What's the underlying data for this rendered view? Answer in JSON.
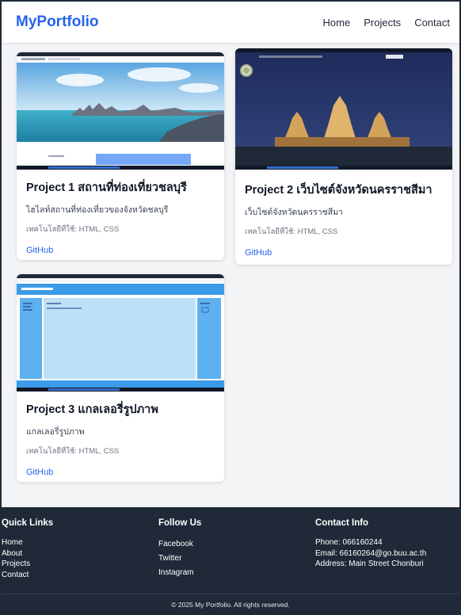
{
  "header": {
    "brand": "MyPortfolio",
    "nav": [
      "Home",
      "Projects",
      "Contact"
    ]
  },
  "projects": [
    {
      "title": "Project 1 สถานที่ท่องเที่ยวชลบุรี",
      "description": "ไฮไลท์สถานที่ท่องเที่ยวของจังหวัดชลบุรี",
      "tech": "เทคโนโลยีที่ใช้: HTML, CSS",
      "link": "GitHub"
    },
    {
      "title": "Project 2 เว็บไซต์จังหวัดนครราชสีมา",
      "description": "เว็บไซต์จังหวัดนครราชสีมา",
      "tech": "เทคโนโลยีที่ใช้: HTML, CSS",
      "link": "GitHub"
    },
    {
      "title": "Project 3 แกลเลอรี่รูปภาพ",
      "description": "แกลเลอรี่รูปภาพ",
      "tech": "เทคโนโลยีที่ใช้: HTML, CSS",
      "link": "GitHub"
    }
  ],
  "footer": {
    "quick_links_title": "Quick Links",
    "quick_links": [
      "Home",
      "About",
      "Projects",
      "Contact"
    ],
    "follow_title": "Follow Us",
    "follow_links": [
      "Facebook",
      "Twitter",
      "Instagram"
    ],
    "contact_title": "Contact Info",
    "contact": [
      "Phone: 066160244",
      "Email: 66160264@go.buu.ac.th",
      "Address: Main Street Chonburi"
    ],
    "copyright": "© 2025 My Portfolio. All rights reserved."
  },
  "colors": {
    "brand": "#2563eb",
    "footer_bg": "#1f2937",
    "page_bg": "#f3f4f6"
  }
}
